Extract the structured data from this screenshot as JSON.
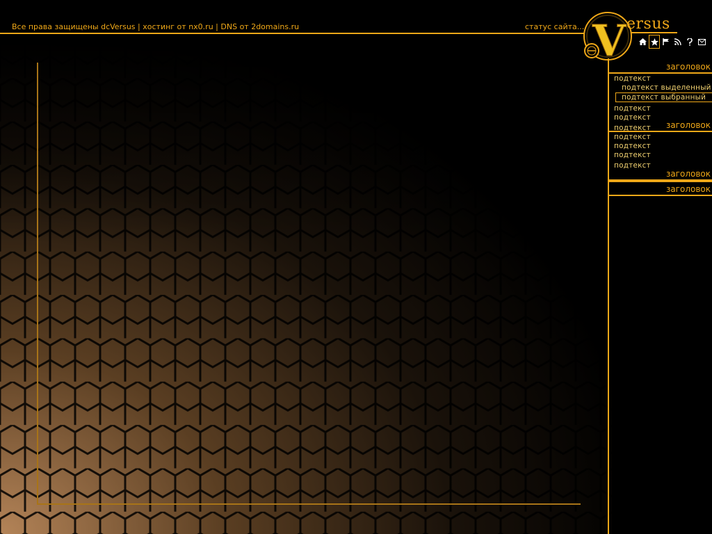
{
  "footer": {
    "copyright_prefix": "Все права защищены ",
    "copyright_brand": "dcVersus",
    "sep1": " | хостинг от ",
    "host": "nx0.ru",
    "sep2": " | DNS от ",
    "dns": "2domains.ru"
  },
  "status_text": "статус сайта...",
  "logo": {
    "letter": "V",
    "rest": "ersus"
  },
  "icons": [
    "home-icon",
    "star-icon",
    "flag-icon",
    "rss-icon",
    "help-icon",
    "mail-icon"
  ],
  "icons_active_index": 1,
  "sidebar": {
    "groups": [
      {
        "header": "заголовок",
        "items": [
          {
            "label": "подтекст",
            "state": "normal"
          },
          {
            "label": "подтекст  выделенный",
            "state": "highlight"
          },
          {
            "label": "подтекст  выбранный",
            "state": "selected"
          },
          {
            "label": "подтекст",
            "state": "normal"
          },
          {
            "label": "подтекст",
            "state": "normal"
          },
          {
            "label": "подтекст",
            "state": "normal"
          }
        ]
      },
      {
        "header": "заголовок",
        "items": [
          {
            "label": "подтекст",
            "state": "normal"
          },
          {
            "label": "подтекст",
            "state": "normal"
          },
          {
            "label": "подтекст",
            "state": "normal"
          },
          {
            "label": "подтекст",
            "state": "normal"
          }
        ]
      },
      {
        "header": "заголовок",
        "items": []
      },
      {
        "header": "заголовок",
        "items": []
      }
    ]
  },
  "colors": {
    "accent": "#f0a818",
    "text_light": "#f0d070",
    "background": "#000000"
  }
}
